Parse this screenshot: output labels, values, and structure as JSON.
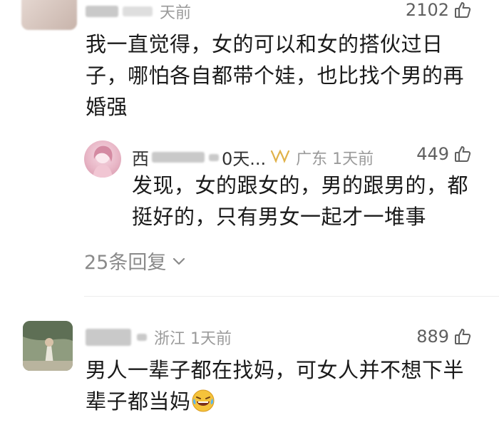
{
  "comments": [
    {
      "time": "天前",
      "likes": "2102",
      "text": "我一直觉得，女的可以和女的搭伙过日子，哪怕各自都带个娃，也比找个男的再婚强"
    },
    {
      "time": "浙江 1天前",
      "likes": "889",
      "text": "男人一辈子都在找妈，可女人并不想下半辈子都当妈"
    }
  ],
  "reply": {
    "name_visible": "西",
    "name_suffix": "0天...",
    "location_time": "广东 1天前",
    "likes": "449",
    "text": "发现，女的跟女的，男的跟男的，都挺好的，只有男女一起才一堆事"
  },
  "more_replies": "25条回复",
  "icons": {
    "like": "thumbs-up-icon",
    "chevron": "chevron-down-icon",
    "badge": "bow-badge-icon",
    "emoji": "laughing-tears-emoji-icon"
  },
  "colors": {
    "meta": "#9a9a9a",
    "badge": "#e0b24a",
    "emoji": "#f5c33b"
  }
}
